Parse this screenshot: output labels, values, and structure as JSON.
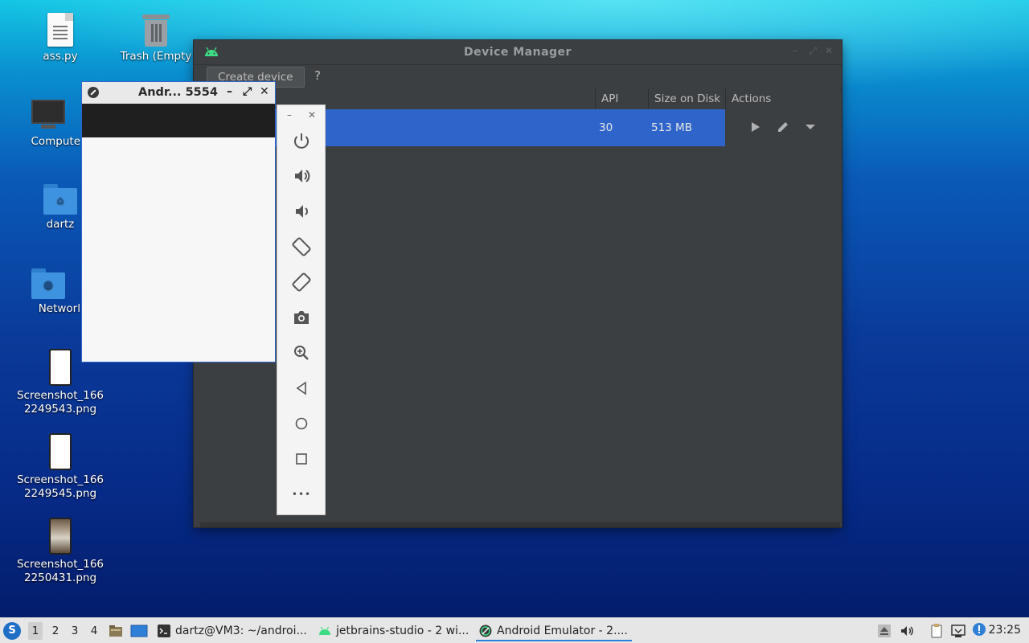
{
  "desktop": {
    "icons": [
      {
        "label": "ass.py",
        "icon": "python-file-icon"
      },
      {
        "label": "Trash (Empty)",
        "icon": "trash-icon"
      },
      {
        "label": "Computer",
        "icon": "computer-icon"
      },
      {
        "label": "dartz",
        "icon": "home-folder-icon"
      },
      {
        "label": "Network",
        "icon": "network-folder-icon"
      },
      {
        "label": "Screenshot_1662249543.png",
        "icon": "image-file-icon"
      },
      {
        "label": "Screenshot_1662249545.png",
        "icon": "image-file-icon"
      },
      {
        "label": "Screenshot_1662250431.png",
        "icon": "image-file-icon"
      }
    ],
    "trash_label_visible": "Trash (Empty",
    "computer_label_visible": "Compute",
    "network_label_visible": "Networl",
    "ss1_l1": "Screenshot_166",
    "ss1_l2": "2249543.png",
    "ss2_l1": "Screenshot_166",
    "ss2_l2": "2249545.png",
    "ss3_l1": "Screenshot_166",
    "ss3_l2": "2250431.png"
  },
  "device_manager": {
    "title": "Device Manager",
    "create_device_label": "Create device",
    "help_label": "?",
    "columns": [
      "API",
      "Size on Disk",
      "Actions"
    ],
    "rows": [
      {
        "api": "30",
        "size": "513 MB",
        "selected": true
      }
    ],
    "actions": [
      "run-icon",
      "edit-icon",
      "more-dropdown-icon"
    ]
  },
  "emulator": {
    "title": "Andr... 5554",
    "title_buttons": [
      "–",
      "⤢",
      "✕"
    ],
    "toolbar": [
      "power-icon",
      "volume-up-icon",
      "volume-down-icon",
      "rotate-left-icon",
      "rotate-right-icon",
      "camera-icon",
      "zoom-icon",
      "back-icon",
      "home-icon",
      "overview-icon",
      "more-icon"
    ],
    "more_label": "•••"
  },
  "taskbar": {
    "workspaces": [
      "1",
      "2",
      "3",
      "4"
    ],
    "active_workspace": "1",
    "tasks": [
      {
        "label": "dartz@VM3: ~/androi...",
        "icon": "terminal-icon"
      },
      {
        "label": "jetbrains-studio - 2 wi...",
        "icon": "android-icon"
      },
      {
        "label": "Android Emulator - 2....",
        "icon": "emulator-icon",
        "active": true
      }
    ],
    "clock": "23:25"
  },
  "colors": {
    "selection": "#2f65ca",
    "dark_panel": "#3c3f41",
    "taskbar": "#e6e6e6"
  }
}
